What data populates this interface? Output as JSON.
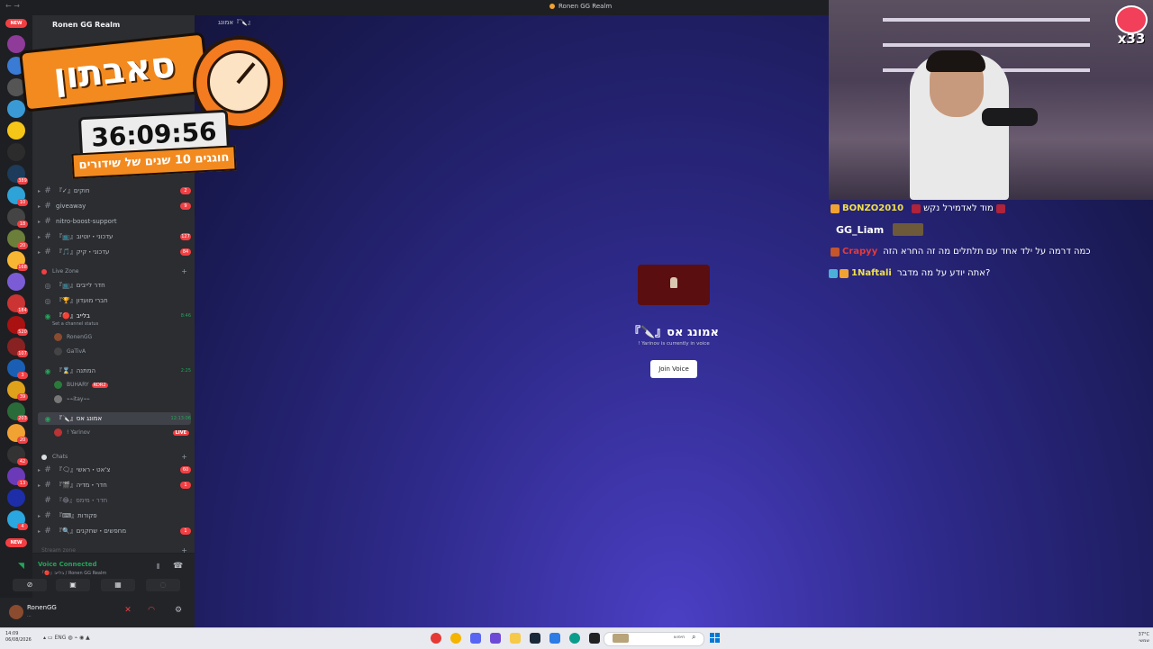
{
  "window": {
    "title": "Ronen GG Realm"
  },
  "server": {
    "name": "Ronen GG Realm"
  },
  "rail": {
    "new_top": "NEW",
    "new_bottom": "NEW",
    "badges": [
      "389",
      "10",
      "18",
      "20",
      "168",
      "184",
      "520",
      "107",
      "3",
      "39",
      "203",
      "20",
      "42",
      "13",
      "4",
      "58"
    ]
  },
  "channels": {
    "text": [
      {
        "label": "『✓』חוקים",
        "badge": "2"
      },
      {
        "label": "giveaway",
        "badge": "9"
      },
      {
        "label": "nitro-boost-support",
        "badge": ""
      },
      {
        "label": "『📺』עדכוני・יוטיוב",
        "badge": "127"
      },
      {
        "label": "『🎵』עדכוני・קיק",
        "badge": "84"
      }
    ],
    "live_zone": "Live Zone",
    "voice": [
      {
        "label": "『📺』חדר לייבים",
        "time": ""
      },
      {
        "label": "『🏆』חברי מועדון",
        "time": ""
      },
      {
        "label": "『🔴』בלייב",
        "time": "8:46",
        "status": "Set a channel status",
        "members": [
          "RonenGG",
          "GaTivA"
        ]
      },
      {
        "label": "『⌛』המתנה",
        "time": "2:25",
        "members": [
          "BUHARY",
          "⌁⌁itay⌁⌁"
        ],
        "tag": "RDR2"
      },
      {
        "label": "『🔪』אמונג אס",
        "time": "12:13:06",
        "members": [
          "! Yarinov"
        ],
        "live": "LIVE"
      }
    ],
    "chats": "Chats",
    "chat_channels": [
      {
        "label": "『🗨』צ'אט・ראשי",
        "badge": "60"
      },
      {
        "label": "『🎬』חדר・מדיה",
        "badge": "1"
      },
      {
        "label": "『😂』חדר・מימס",
        "badge": ""
      },
      {
        "label": "『⌨』פקודות",
        "badge": ""
      },
      {
        "label": "『🔍』מחפשים・שחקנים",
        "badge": "1"
      }
    ],
    "stream_zone": "Stream zone"
  },
  "voice_panel": {
    "title": "Voice Connected",
    "subtitle": "『🔴』בלייב / Ronen GG Realm"
  },
  "user": {
    "name": "RonenGG",
    "status": "..."
  },
  "stage": {
    "tab": "אמונג『🔪』",
    "channel_name": "『🔪』אמונג אס",
    "subtitle": "! Yarinov is currently in voice",
    "join_label": "Join Voice"
  },
  "overlay": {
    "subathon_title": "סאבתון",
    "timer": "36:09:56",
    "strip": "חוגגים 10 שנים של שידורים"
  },
  "bits": {
    "count": "x33"
  },
  "chat": [
    {
      "name": "BONZO2010",
      "message": "מוד לאדמירל נקש",
      "name_color": "#f0e04a"
    },
    {
      "name": "GG_Liam",
      "message": "",
      "name_color": "#ffffff"
    },
    {
      "name": "Crapyy",
      "message": "כמה דרמה על ילד אחד עם תלתלים מה זה החרא הזה",
      "name_color": "#e63a3a"
    },
    {
      "name": "1Naftali",
      "message": "?אתה יודע על מה מדבר",
      "name_color": "#f0e04a"
    }
  ],
  "taskbar": {
    "time": "14:09",
    "date": "06/08/2026",
    "lang": "ENG",
    "search": "חיפוש",
    "weather_temp": "37°C",
    "weather_desc": "שמשי"
  }
}
